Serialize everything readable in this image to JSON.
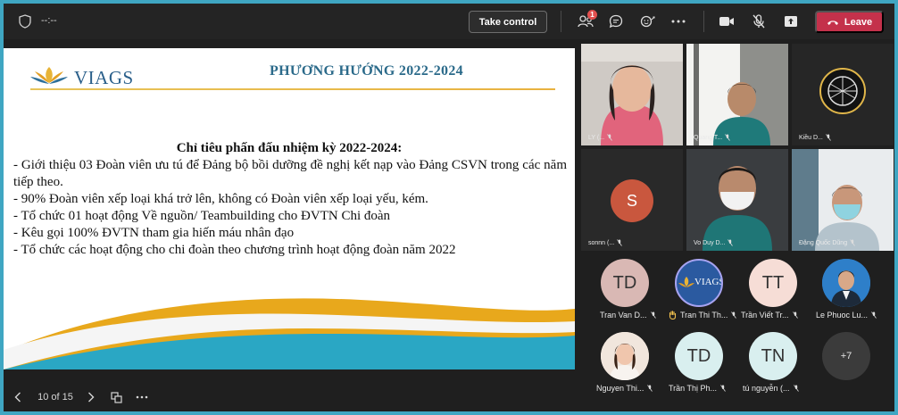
{
  "topbar": {
    "timer": "--:--",
    "take_control_label": "Take control",
    "participants_badge": "1",
    "leave_label": "Leave"
  },
  "slide": {
    "logo_text": "VIAGS",
    "title": "PHƯƠNG HƯỚNG 2022-2024",
    "subtitle": "Chỉ tiêu phấn đấu nhiệm kỳ 2022-2024:",
    "bullets": [
      "- Giới thiệu 03 Đoàn viên ưu tú để Đảng bộ bồi dưỡng đề nghị kết nạp vào Đảng CSVN trong các năm tiếp theo.",
      "- 90% Đoàn viên xếp loại khá trở lên, không có Đoàn viên xếp loại yếu, kém.",
      "- Tổ chức 01 hoạt động Về nguồn/ Teambuilding cho ĐVTN Chi đoàn",
      "- Kêu gọi 100% ĐVTN tham gia hiến máu nhân đạo",
      "- Tổ chức các hoạt động cho chi đoàn theo chương trình hoạt động đoàn năm 2022"
    ],
    "page_indicator": "10 of 15"
  },
  "video_tiles": [
    {
      "name": "LY (..."
    },
    {
      "name": "Quang T..."
    },
    {
      "name": "Kiều D..."
    },
    {
      "name": "sonnn (...",
      "initial": "S"
    },
    {
      "name": "Vo Duy D..."
    },
    {
      "name": "Đặng Quốc Dũng"
    }
  ],
  "participants": [
    {
      "initials": "TD",
      "name": "Tran Van D..."
    },
    {
      "initials": "",
      "name": "Tran Thi Th...",
      "logo": "VIAGS"
    },
    {
      "initials": "TT",
      "name": "Trần Viết Tr..."
    },
    {
      "initials": "",
      "name": "Le Phuoc Lu..."
    },
    {
      "initials": "",
      "name": "Nguyen Thi..."
    },
    {
      "initials": "TD",
      "name": "Trần Thị Ph..."
    },
    {
      "initials": "TN",
      "name": "tú nguyễn (..."
    },
    {
      "initials": "+7",
      "name": ""
    }
  ],
  "colors": {
    "leave": "#c4314b",
    "badge": "#e3504f",
    "slide_title": "#2b6a8a",
    "wave_teal": "#2aa7c4",
    "wave_gold": "#e8a81c",
    "sonnn_avatar": "#c9573e"
  }
}
